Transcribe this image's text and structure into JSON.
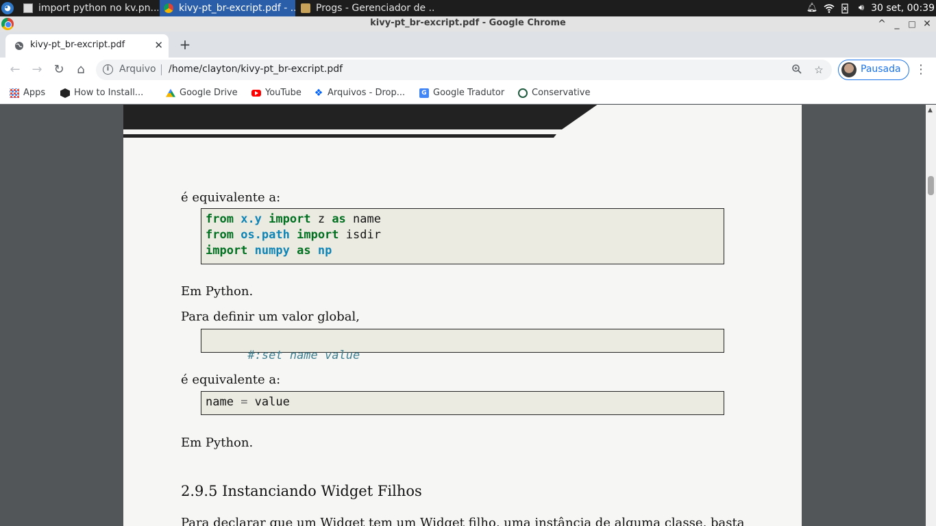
{
  "taskbar": {
    "tasks": [
      {
        "label": "import python no kv.pn...",
        "icon": "image-file-icon"
      },
      {
        "label": "kivy-pt_br-excript.pdf - ...",
        "icon": "chrome-icon"
      },
      {
        "label": "Progs - Gerenciador de ...",
        "icon": "folder-icon"
      }
    ],
    "clock": "30 set, 00:39"
  },
  "window": {
    "title": "kivy-pt_br-excript.pdf - Google Chrome",
    "controls": {
      "up": "^",
      "minimize": "_",
      "maximize": "□",
      "close": "✕"
    }
  },
  "tab": {
    "label": "kivy-pt_br-excript.pdf",
    "close": "✕",
    "new_tab": "+"
  },
  "toolbar": {
    "back": "←",
    "forward": "→",
    "reload": "↻",
    "home": "⌂",
    "scheme": "Arquivo",
    "url": "/home/clayton/kivy-pt_br-excript.pdf",
    "profile": "Pausada",
    "menu": "⋮"
  },
  "bookmarks": [
    {
      "label": "Apps",
      "icon": "apps-grid-icon"
    },
    {
      "label": "How to Install...",
      "icon": "hexagon-icon"
    },
    {
      "label": "Google Drive",
      "icon": "google-drive-icon"
    },
    {
      "label": "YouTube",
      "icon": "youtube-icon"
    },
    {
      "label": "Arquivos - Drop...",
      "icon": "dropbox-icon"
    },
    {
      "label": "Google Tradutor",
      "icon": "google-translate-icon"
    },
    {
      "label": "Conservative",
      "icon": "conservative-icon"
    }
  ],
  "document": {
    "p1": "é equivalente a:",
    "code1": [
      [
        {
          "t": "from",
          "c": "kw"
        },
        {
          "t": " ",
          "c": ""
        },
        {
          "t": "x.y",
          "c": "mod"
        },
        {
          "t": " ",
          "c": ""
        },
        {
          "t": "import",
          "c": "kw"
        },
        {
          "t": " z ",
          "c": ""
        },
        {
          "t": "as",
          "c": "kw"
        },
        {
          "t": " name",
          "c": ""
        }
      ],
      [
        {
          "t": "from",
          "c": "kw"
        },
        {
          "t": " ",
          "c": ""
        },
        {
          "t": "os.path",
          "c": "mod"
        },
        {
          "t": " ",
          "c": ""
        },
        {
          "t": "import",
          "c": "kw"
        },
        {
          "t": " isdir",
          "c": ""
        }
      ],
      [
        {
          "t": "import",
          "c": "kw"
        },
        {
          "t": " ",
          "c": ""
        },
        {
          "t": "numpy",
          "c": "mod"
        },
        {
          "t": " ",
          "c": ""
        },
        {
          "t": "as",
          "c": "kw"
        },
        {
          "t": " ",
          "c": ""
        },
        {
          "t": "np",
          "c": "mod"
        }
      ]
    ],
    "p2": "Em Python.",
    "p3": "Para definir um valor global,",
    "code2": "#:set name value",
    "p4": "é equivalente a:",
    "code3": [
      [
        {
          "t": "name",
          "c": ""
        },
        {
          "t": " = ",
          "c": "op"
        },
        {
          "t": "value",
          "c": ""
        }
      ]
    ],
    "p5": "Em Python.",
    "heading": "2.9.5  Instanciando  Widget Filhos",
    "p6_partial": "Para declarar que um Widget tem um Widget filho, uma instância de alguma classe, basta"
  }
}
